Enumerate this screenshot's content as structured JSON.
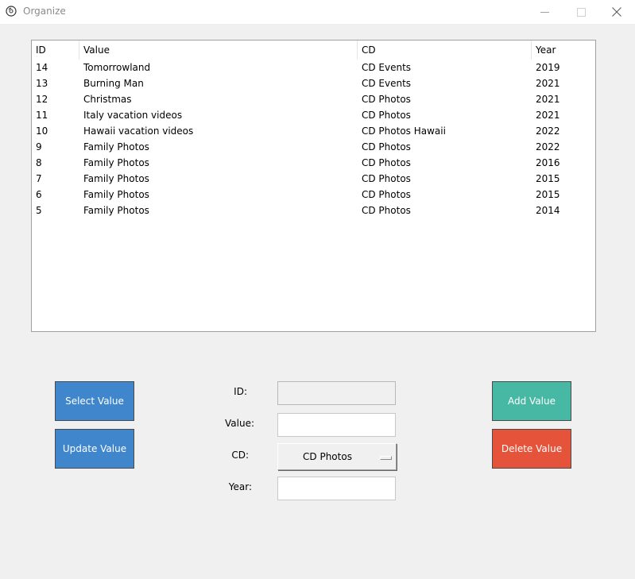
{
  "window": {
    "title": "Organize"
  },
  "table": {
    "columns": [
      "ID",
      "Value",
      "CD",
      "Year"
    ],
    "rows": [
      {
        "id": "14",
        "value": "Tomorrowland",
        "cd": "CD Events",
        "year": "2019"
      },
      {
        "id": "13",
        "value": "Burning Man",
        "cd": "CD Events",
        "year": "2021"
      },
      {
        "id": "12",
        "value": "Christmas",
        "cd": "CD Photos",
        "year": "2021"
      },
      {
        "id": "11",
        "value": "Italy vacation videos",
        "cd": "CD Photos",
        "year": "2021"
      },
      {
        "id": "10",
        "value": "Hawaii vacation videos",
        "cd": "CD Photos Hawaii",
        "year": "2022"
      },
      {
        "id": "9",
        "value": "Family Photos",
        "cd": "CD Photos",
        "year": "2022"
      },
      {
        "id": "8",
        "value": "Family Photos",
        "cd": "CD Photos",
        "year": "2016"
      },
      {
        "id": "7",
        "value": "Family Photos",
        "cd": "CD Photos",
        "year": "2015"
      },
      {
        "id": "6",
        "value": "Family Photos",
        "cd": "CD Photos",
        "year": "2015"
      },
      {
        "id": "5",
        "value": "Family Photos",
        "cd": "CD Photos",
        "year": "2014"
      }
    ]
  },
  "buttons": {
    "select": "Select Value",
    "update": "Update Value",
    "add": "Add Value",
    "delete": "Delete Value"
  },
  "form": {
    "id_label": "ID:",
    "id_value": "",
    "value_label": "Value:",
    "value_value": "",
    "cd_label": "CD:",
    "cd_selected": "CD Photos",
    "year_label": "Year:",
    "year_value": ""
  },
  "colors": {
    "select_button": "#3f86cc",
    "update_button": "#3f86cc",
    "add_button": "#46b8a3",
    "delete_button": "#e5533a"
  },
  "icons": {
    "app": "cd-disc-icon",
    "minimize": "minimize-icon",
    "maximize": "maximize-icon",
    "close": "close-icon"
  }
}
